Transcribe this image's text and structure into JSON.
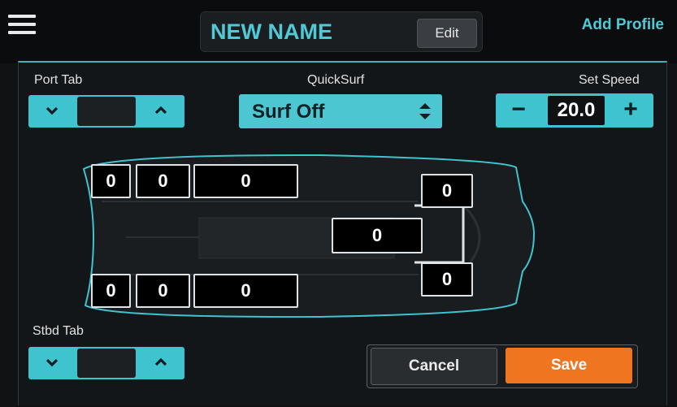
{
  "header": {
    "profile_name": "NEW NAME",
    "edit_label": "Edit",
    "add_profile_label": "Add Profile"
  },
  "port_tab": {
    "label": "Port Tab"
  },
  "stbd_tab": {
    "label": "Stbd Tab"
  },
  "quicksurf": {
    "label": "QuickSurf",
    "value": "Surf Off"
  },
  "set_speed": {
    "label": "Set Speed",
    "value": "20.0",
    "minus": "−",
    "plus": "+"
  },
  "ballast": {
    "port_fwd_1": "0",
    "port_fwd_2": "0",
    "port_mid": "0",
    "stbd_fwd_1": "0",
    "stbd_fwd_2": "0",
    "stbd_mid": "0",
    "center": "0",
    "aft_port": "0",
    "aft_stbd": "0"
  },
  "footer": {
    "cancel_label": "Cancel",
    "save_label": "Save"
  },
  "colors": {
    "accent": "#3ec3cf",
    "title": "#4fc9d6",
    "save": "#f07520"
  }
}
